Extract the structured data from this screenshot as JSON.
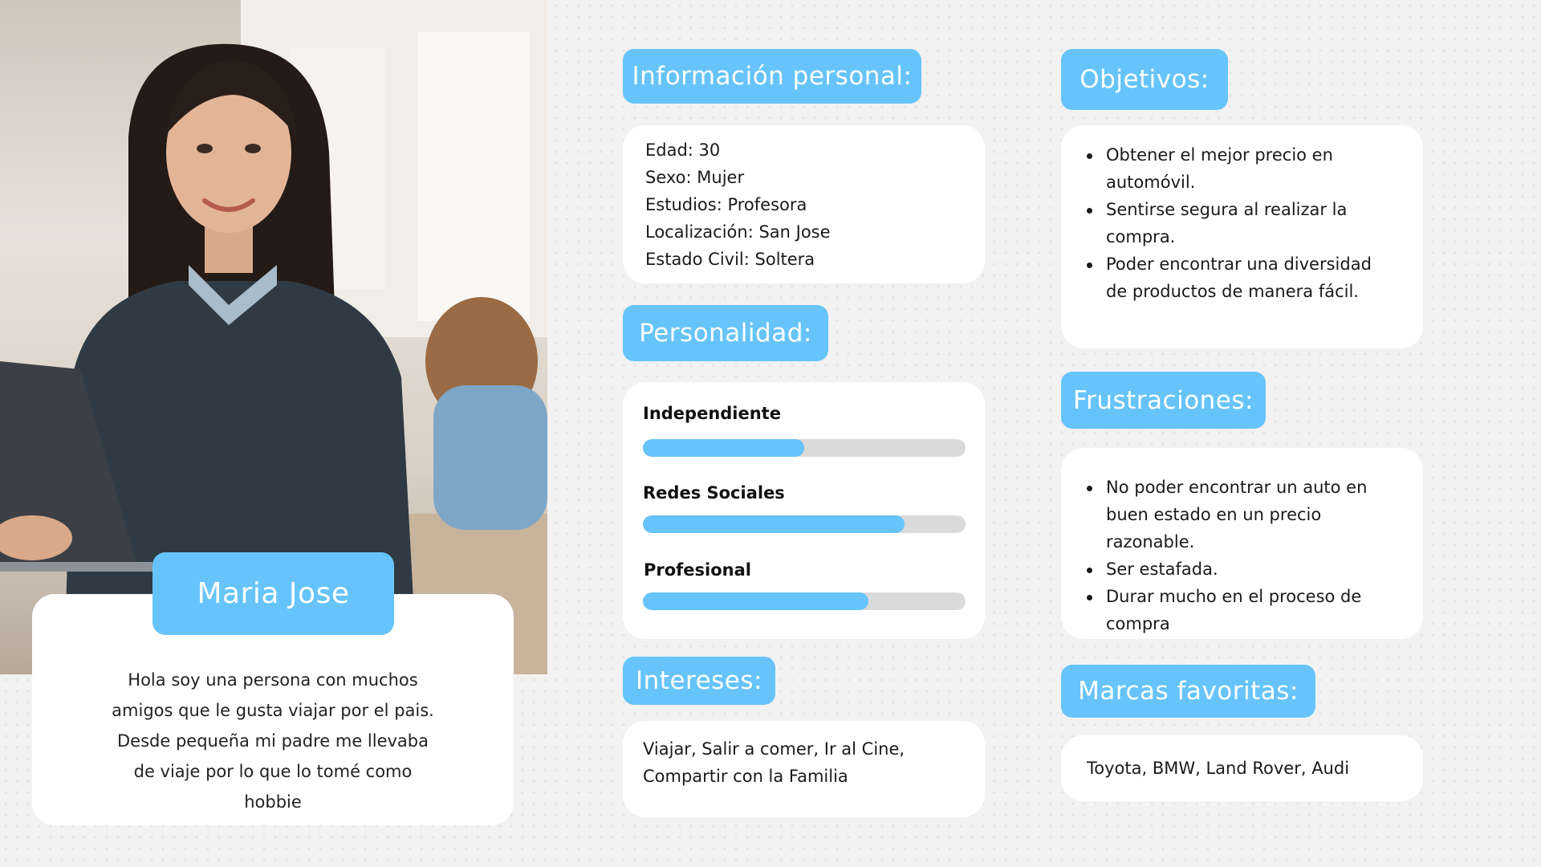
{
  "persona": {
    "name": "Maria Jose",
    "bio": "Hola soy una persona con muchos amigos que le gusta viajar por el pais. Desde pequeña mi padre me llevaba de viaje por lo que lo tomé como hobbie",
    "photo_alt": "woman-holding-laptop-icon"
  },
  "personal_info": {
    "title": "Información personal:",
    "lines": [
      "Edad: 30",
      "Sexo: Mujer",
      "Estudios: Profesora",
      "Localización: San Jose",
      "Estado Civil: Soltera"
    ]
  },
  "personality": {
    "title": "Personalidad:",
    "traits": [
      {
        "label": "Independiente",
        "value": 0.5
      },
      {
        "label": "Redes Sociales",
        "value": 0.81
      },
      {
        "label": "Profesional",
        "value": 0.7
      }
    ]
  },
  "interests": {
    "title": "Intereses:",
    "text": "Viajar, Salir a comer, Ir al Cine, Compartir con la Familia"
  },
  "objectives": {
    "title": "Objetivos:",
    "items": [
      "Obtener el mejor precio en automóvil.",
      "Sentirse segura al realizar la compra.",
      "Poder encontrar una diversidad de productos de manera fácil."
    ]
  },
  "frustrations": {
    "title": "Frustraciones:",
    "items": [
      "No poder encontrar un auto en buen estado en un precio razonable.",
      "Ser estafada.",
      "Durar mucho en el proceso de compra"
    ]
  },
  "brands": {
    "title": "Marcas favoritas:",
    "text": "Toyota, BMW, Land Rover, Audi"
  },
  "colors": {
    "accent": "#66c4fb",
    "card": "#ffffff",
    "track": "#dadada",
    "background": "#f2f2f2"
  }
}
